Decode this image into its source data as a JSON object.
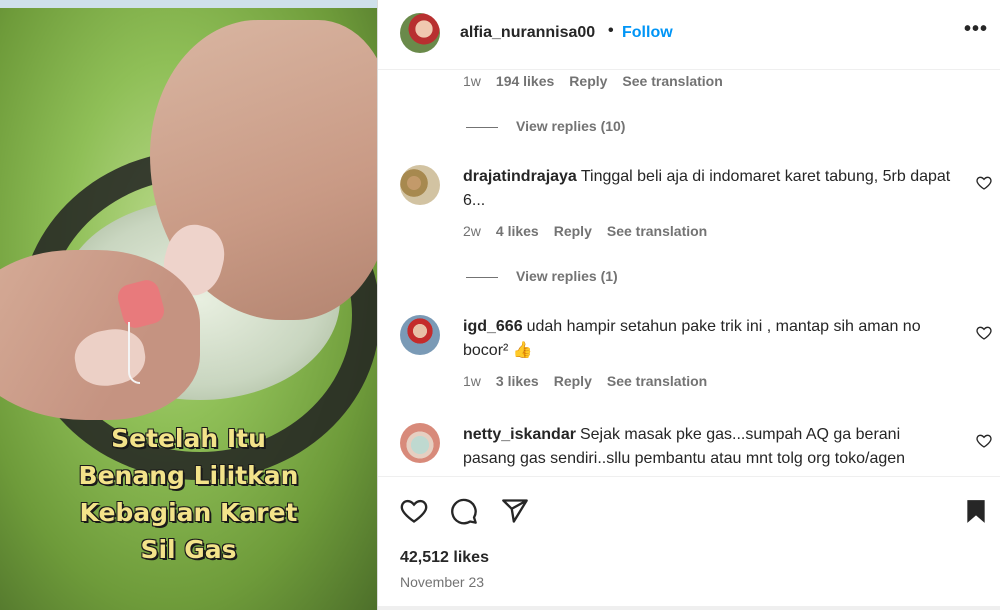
{
  "media": {
    "caption_lines": [
      "Setelah Itu",
      "Benang Lilitkan",
      "Kebagian Karet",
      "Sil Gas"
    ]
  },
  "header": {
    "username": "alfia_nurannisa00",
    "separator": "•",
    "follow_label": "Follow",
    "more_label": "•••"
  },
  "comments": {
    "first_meta": {
      "age": "1w",
      "likes": "194 likes",
      "reply": "Reply",
      "translate": "See translation"
    },
    "first_view_replies": "View replies (10)",
    "items": [
      {
        "username": "drajatindrajaya",
        "text": "Tinggal beli aja di indomaret karet tabung, 5rb dapat 6...",
        "age": "2w",
        "likes": "4 likes",
        "reply": "Reply",
        "translate": "See translation",
        "view_replies": "View replies (1)"
      },
      {
        "username": "igd_666",
        "text": "udah hampir setahun pake trik ini , mantap sih aman no bocor² 👍",
        "age": "1w",
        "likes": "3 likes",
        "reply": "Reply",
        "translate": "See translation"
      },
      {
        "username": "netty_iskandar",
        "text": "Sejak masak pke gas...sumpah AQ ga berani pasang gas sendiri..sllu pembantu atau mnt tolg org toko/agen"
      }
    ]
  },
  "actions": {
    "likes": "42,512 likes",
    "date": "November 23"
  },
  "icons": {
    "like": "heart-icon",
    "comment": "comment-icon",
    "share": "share-icon",
    "save": "bookmark-icon",
    "more": "more-options-icon"
  },
  "colors": {
    "link": "#0095f6",
    "secondary": "#737373",
    "text": "#262626"
  }
}
